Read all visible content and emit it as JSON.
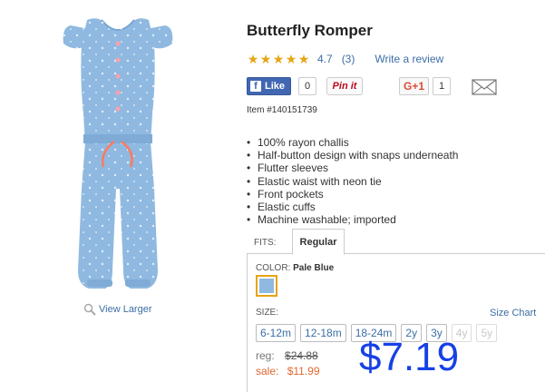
{
  "product": {
    "title": "Butterfly Romper",
    "rating_value": "4.7",
    "review_count": "(3)",
    "write_review": "Write a review",
    "stars": 4.7,
    "item_number": "Item #140151739",
    "view_larger": "View Larger",
    "features": [
      "100% rayon challis",
      "Half-button design with snaps underneath",
      "Flutter sleeves",
      "Elastic waist with neon tie",
      "Front pockets",
      "Elastic cuffs",
      "Machine washable; imported"
    ]
  },
  "social": {
    "fb_label": "Like",
    "fb_count": "0",
    "pinit": "Pin it",
    "gplus": "G+1",
    "gplus_count": "1",
    "email_icon": "envelope-icon"
  },
  "fits": {
    "label": "FITS:",
    "tab": "Regular"
  },
  "color": {
    "label": "COLOR:",
    "value": "Pale Blue",
    "swatch_color": "#8fb9e0"
  },
  "size": {
    "label": "SIZE:",
    "chart_link": "Size Chart",
    "options": [
      "6-12m",
      "12-18m",
      "18-24m",
      "2y",
      "3y",
      "4y",
      "5y"
    ],
    "disabled": [
      "4y",
      "5y"
    ]
  },
  "pricing": {
    "reg_label": "reg:",
    "reg_price": "$24.88",
    "sale_label": "sale:",
    "sale_price": "$11.99",
    "overlay_price": "$7.19",
    "overlay_color": "#1741e6",
    "sale_color": "#e2672f"
  },
  "colors": {
    "link": "#3b6ea5",
    "star": "#e7a513",
    "facebook": "#4267b2"
  }
}
